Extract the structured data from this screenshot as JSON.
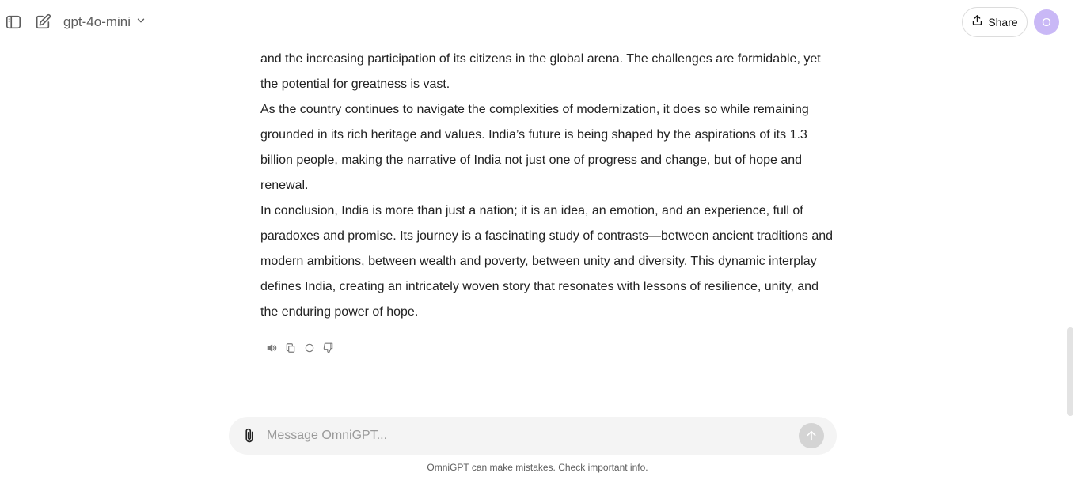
{
  "header": {
    "model_name": "gpt-4o-mini",
    "share_label": "Share",
    "avatar_initial": "O",
    "icons": [
      "sidebar-icon",
      "new-chat-icon",
      "chevron-down-icon",
      "share-icon"
    ]
  },
  "message": {
    "paragraphs": [
      "and the increasing participation of its citizens in the global arena. The challenges are formidable, yet the potential for greatness is vast.",
      "As the country continues to navigate the complexities of modernization, it does so while remaining grounded in its rich heritage and values. India’s future is being shaped by the aspirations of its 1.3 billion people, making the narrative of India not just one of progress and change, but of hope and renewal.",
      "In conclusion, India is more than just a nation; it is an idea, an emotion, and an experience, full of paradoxes and promise. Its journey is a fascinating study of contrasts—between ancient traditions and modern ambitions, between wealth and poverty, between unity and diversity. This dynamic interplay defines India, creating an intricately woven story that resonates with lessons of resilience, unity, and the enduring power of hope."
    ],
    "actions": [
      "read-aloud-icon",
      "copy-icon",
      "regenerate-icon",
      "thumbs-down-icon"
    ]
  },
  "composer": {
    "placeholder": "Message OmniGPT..."
  },
  "footer": {
    "disclaimer": "OmniGPT can make mistakes. Check important info."
  },
  "colors": {
    "avatar": "#c9b8f6",
    "composer_bg": "#f4f4f4",
    "send_button": "#d4d4d4"
  }
}
